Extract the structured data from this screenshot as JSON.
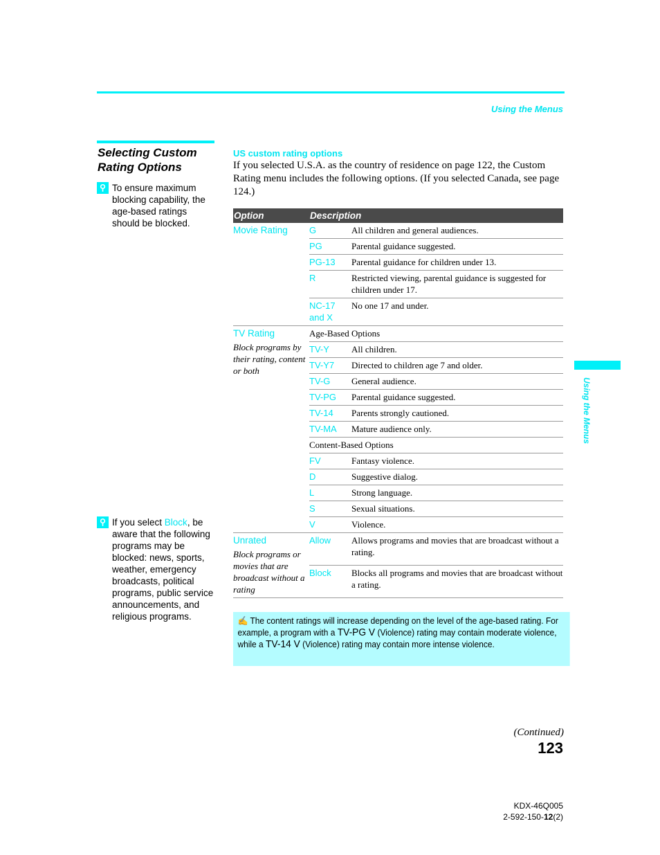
{
  "running_head": "Using the Menus",
  "section_title": "Selecting Custom Rating Options",
  "tips": [
    {
      "icon": "lightbulb-tip-icon",
      "text": "To ensure maximum blocking capability, the age-based ratings should be blocked."
    },
    {
      "icon": "lightbulb-tip-icon",
      "text_before": "If you select ",
      "highlight": "Block",
      "text_after": ", be aware that the following programs may be blocked: news, sports, weather, emergency broadcasts, political programs, public service announcements, and religious programs."
    }
  ],
  "subheading": "US custom rating options",
  "intro": "If you selected U.S.A. as the country of residence on page 122, the Custom Rating menu includes the following options. (If you selected Canada, see page 124.)",
  "table": {
    "headers": [
      "Option",
      "Description"
    ],
    "groups": [
      {
        "option": "Movie Rating",
        "note": "",
        "rows": [
          {
            "code": "G",
            "desc": "All children and general audiences."
          },
          {
            "code": "PG",
            "desc": "Parental guidance suggested."
          },
          {
            "code": "PG-13",
            "desc": "Parental guidance for children under 13."
          },
          {
            "code": "R",
            "desc": "Restricted viewing, parental guidance is suggested for children under 17."
          },
          {
            "code": "NC-17 and X",
            "desc": "No one 17 and under."
          }
        ]
      },
      {
        "option": "TV Rating",
        "note": "Block programs by their rating, content or both",
        "rows": [
          {
            "span": "Age-Based Options"
          },
          {
            "code": "TV-Y",
            "desc": "All children."
          },
          {
            "code": "TV-Y7",
            "desc": "Directed to children age 7 and older."
          },
          {
            "code": "TV-G",
            "desc": "General audience."
          },
          {
            "code": "TV-PG",
            "desc": "Parental guidance suggested."
          },
          {
            "code": "TV-14",
            "desc": "Parents strongly cautioned."
          },
          {
            "code": "TV-MA",
            "desc": "Mature audience only."
          },
          {
            "span": "Content-Based Options"
          },
          {
            "code": "FV",
            "desc": "Fantasy violence."
          },
          {
            "code": "D",
            "desc": "Suggestive dialog."
          },
          {
            "code": "L",
            "desc": "Strong language."
          },
          {
            "code": "S",
            "desc": "Sexual situations."
          },
          {
            "code": "V",
            "desc": "Violence."
          }
        ]
      },
      {
        "option": "Unrated",
        "note": "Block programs or movies that are broadcast without a rating",
        "rows": [
          {
            "code": "Allow",
            "desc": "Allows programs and movies that are broadcast without a rating."
          },
          {
            "code": "Block",
            "desc": "Blocks all programs and movies that are broadcast without a rating."
          }
        ]
      }
    ]
  },
  "note": {
    "icon": "pencil-note-icon",
    "p1": "The content ratings will increase depending on the level of the age-based rating. For example, a program with a ",
    "hl1": "TV-PG V",
    "p2": " (Violence) rating may contain moderate violence, while a ",
    "hl2": "TV-14 V",
    "p3": " (Violence) rating may contain more intense violence."
  },
  "side_tab_label": "Using the Menus",
  "continued": "(Continued)",
  "page_number": "123",
  "model": "KDX-46Q005",
  "part_prefix": "2-592-150-",
  "part_bold": "12",
  "part_suffix": "(2)"
}
